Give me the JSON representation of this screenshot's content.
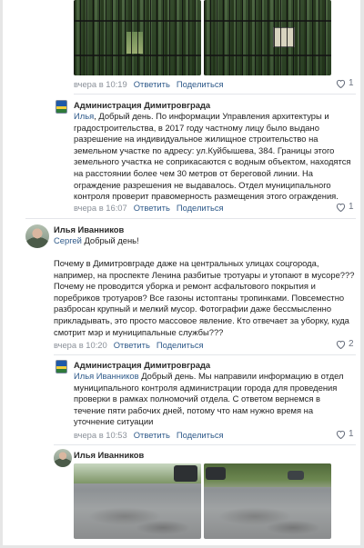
{
  "photos_top": {
    "meta": {
      "time": "вчера в 10:19",
      "reply": "Ответить",
      "share": "Поделиться",
      "likes": "1"
    }
  },
  "comment1": {
    "author": "Администрация Димитровграда",
    "mention": "Илья",
    "lines": [
      ", Добрый день. По информации Управления архитектуры и",
      "градостроительства, в 2017 году частному лицу было выдано",
      "разрешение на индивидуальное жилищное строительство на",
      "земельном участке по адресу: ул.Куйбышева, 384. Границы этого",
      "земельного участка не соприкасаются с водным объектом, находятся",
      "на расстоянии более чем 30 метров от береговой линии. На",
      "ограждение разрешения не выдавалось. Отдел муниципального",
      "контроля проверит правомерность размещения этого ограждения."
    ],
    "meta": {
      "time": "вчера в 16:07",
      "reply": "Ответить",
      "share": "Поделиться",
      "likes": "1"
    }
  },
  "comment2": {
    "author": "Илья Иванников",
    "mention": "Сергей",
    "greeting": " Добрый день!",
    "lines": [
      "Почему в Димитровграде даже на центральных улицах соцгорода,",
      "например, на проспекте Ленина разбитые тротуары и утопают в мусоре???",
      "Почему не проводится уборка и ремонт асфальтового покрытия и",
      "поребриков тротуаров? Все газоны истоптаны тропинками. Повсеместно",
      "разбросан крупный и мелкий мусор. Фотографии даже бессмысленно",
      "прикладывать, это просто массовое явление. Кто отвечает за уборку, куда",
      "смотрит мэр и муниципальные службы???"
    ],
    "meta": {
      "time": "вчера в 10:20",
      "reply": "Ответить",
      "share": "Поделиться",
      "likes": "2"
    }
  },
  "comment3": {
    "author": "Администрация Димитровграда",
    "mention": "Илья Иванников",
    "lines": [
      " Добрый день. Мы направили информацию в отдел",
      "муниципального контроля администрации города для проведения",
      "проверки в рамках полномочий отдела. С ответом вернемся в",
      "течение пяти рабочих дней, потому что нам нужно время на",
      "уточнение ситуации"
    ],
    "meta": {
      "time": "вчера в 10:53",
      "reply": "Ответить",
      "share": "Поделиться",
      "likes": "1"
    }
  },
  "comment4": {
    "author": "Илья Иванников"
  },
  "colors": {
    "link": "#2f5a8a",
    "meta": "#8a9099",
    "text": "#222222"
  }
}
